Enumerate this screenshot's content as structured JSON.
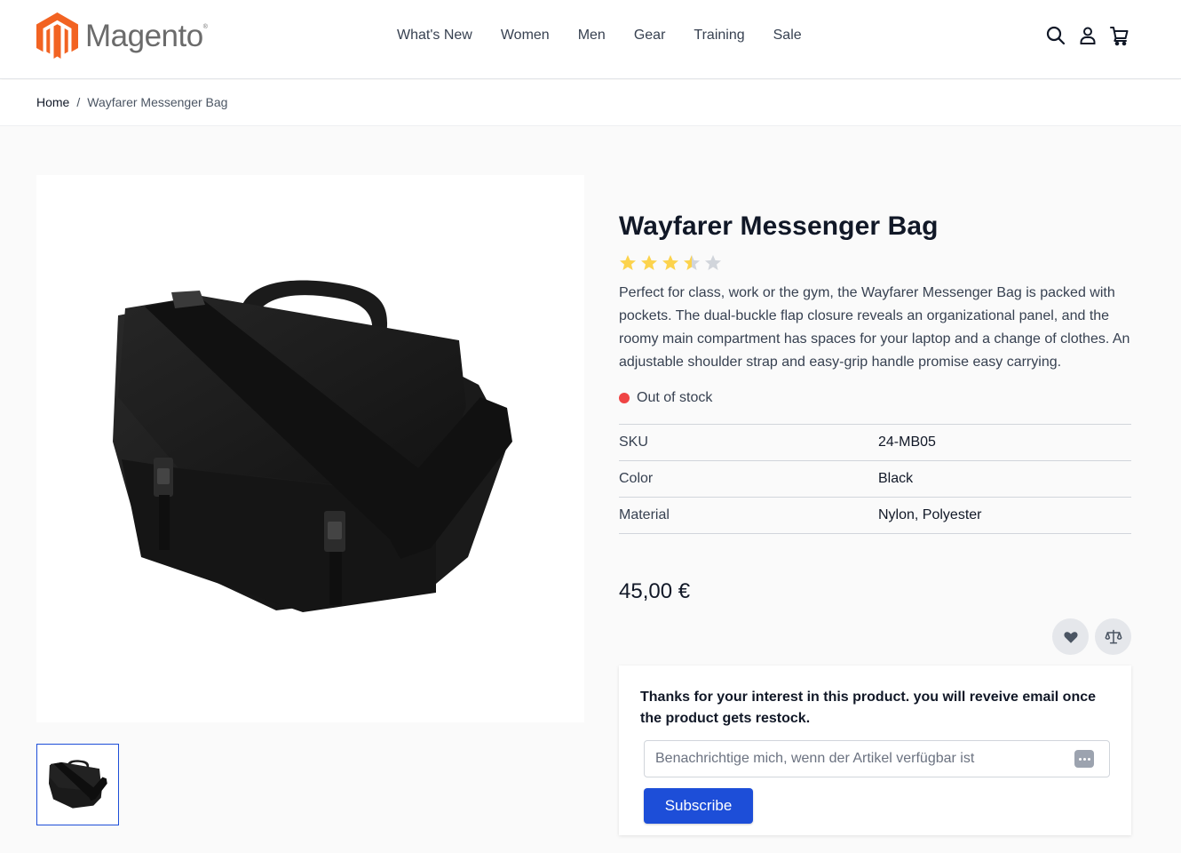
{
  "header": {
    "logo_text": "Magento",
    "logo_reg": "®",
    "nav": [
      "What's New",
      "Women",
      "Men",
      "Gear",
      "Training",
      "Sale"
    ],
    "icons": [
      "search-icon",
      "account-icon",
      "cart-icon"
    ]
  },
  "breadcrumb": {
    "home": "Home",
    "separator": "/",
    "current": "Wayfarer Messenger Bag"
  },
  "product": {
    "title": "Wayfarer Messenger Bag",
    "rating": {
      "value": 3.5,
      "max": 5
    },
    "description": "Perfect for class, work or the gym, the Wayfarer Messenger Bag is packed with pockets. The dual-buckle flap closure reveals an organizational panel, and the roomy main compartment has spaces for your laptop and a change of clothes. An adjustable shoulder strap and easy-grip handle promise easy carrying.",
    "stock_status": "Out of stock",
    "attributes": [
      {
        "label": "SKU",
        "value": "24-MB05"
      },
      {
        "label": "Color",
        "value": "Black"
      },
      {
        "label": "Material",
        "value": "Nylon, Polyester"
      }
    ],
    "price": "45,00 €"
  },
  "actions": {
    "wishlist_icon": "heart-icon",
    "compare_icon": "scale-icon"
  },
  "notify": {
    "message": "Thanks for your interest in this product. you will reveive email once the product gets restock.",
    "placeholder": "Benachrichtige mich, wenn der Artikel verfügbar ist",
    "subscribe_label": "Subscribe"
  },
  "colors": {
    "accent": "#1d4ed8",
    "brand_orange": "#f26322",
    "star": "#fcd34d",
    "star_empty": "#d1d5db",
    "out_of_stock": "#ef4444"
  }
}
